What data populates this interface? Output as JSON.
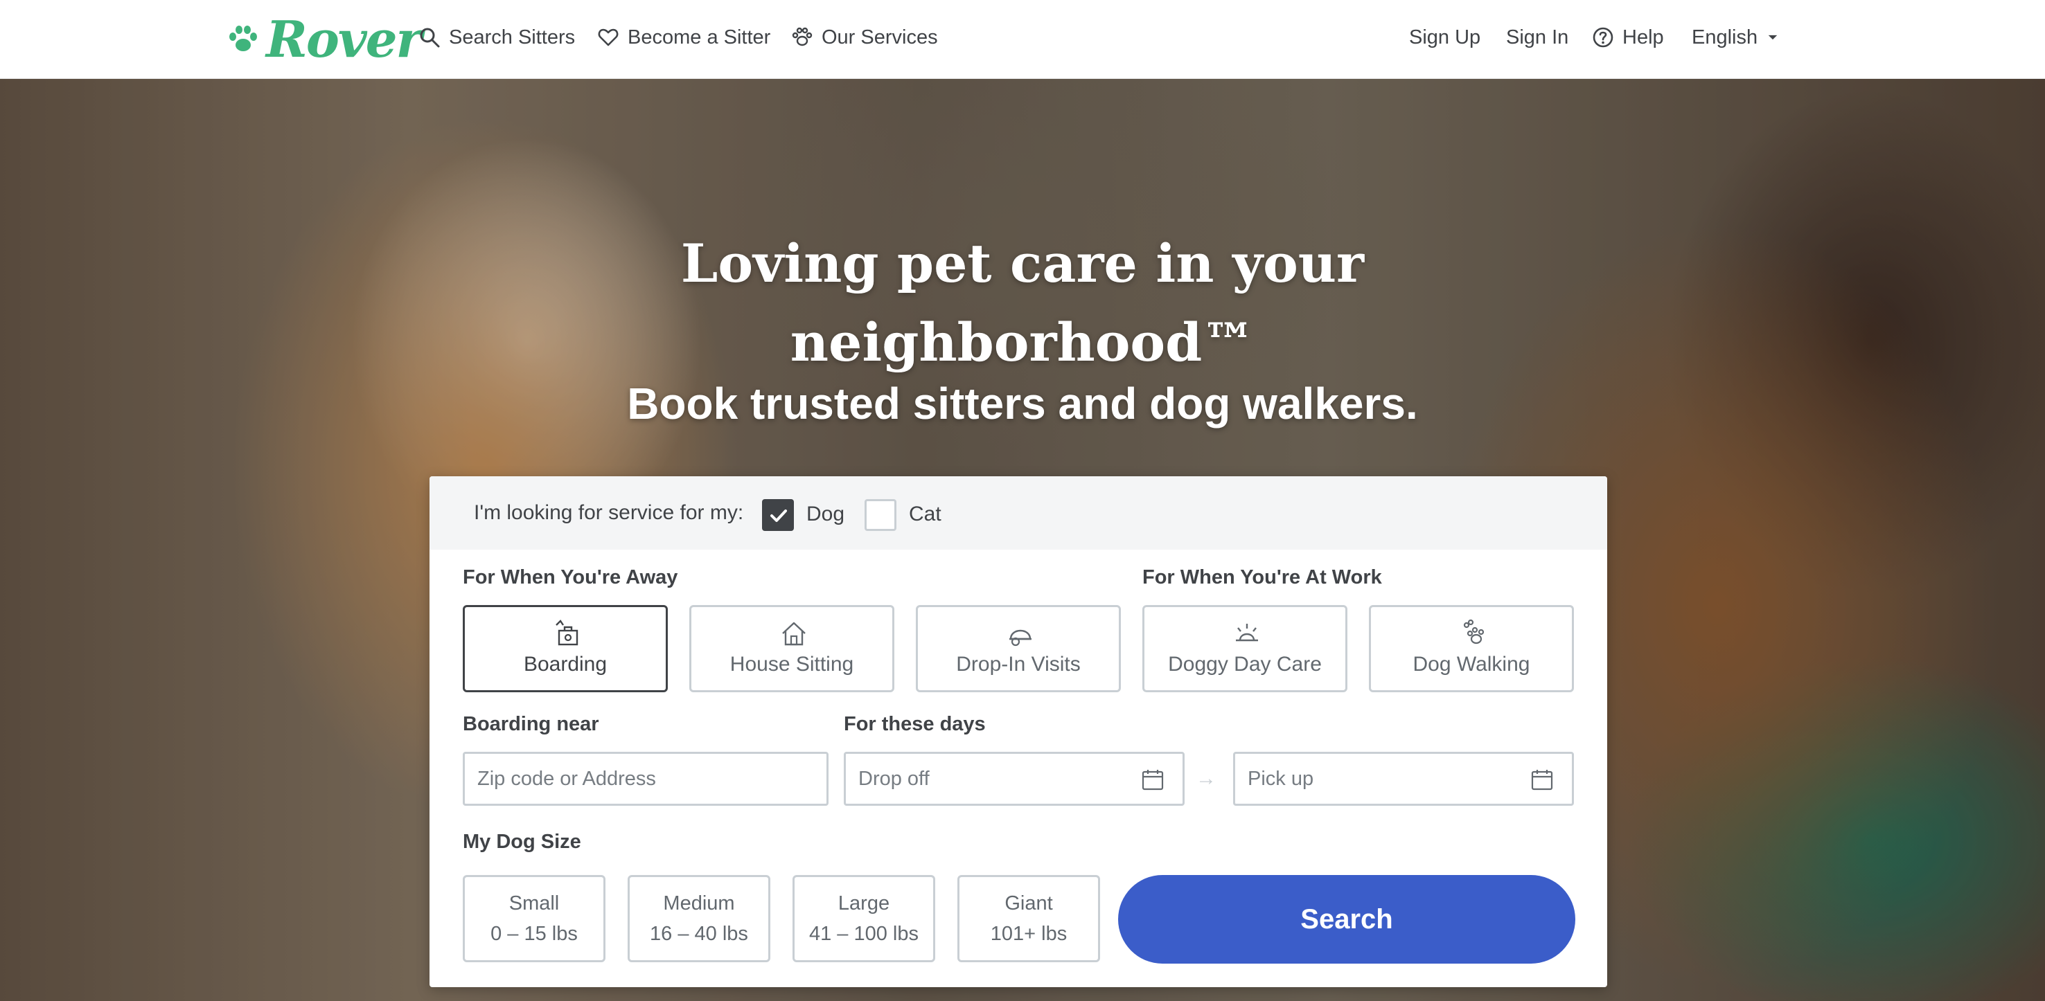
{
  "brand": {
    "name": "Rover",
    "color": "#3fb47c"
  },
  "nav": {
    "search_sitters": "Search Sitters",
    "become_sitter": "Become a Sitter",
    "our_services": "Our Services",
    "sign_up": "Sign Up",
    "sign_in": "Sign In",
    "help": "Help",
    "language": "English"
  },
  "hero": {
    "title_line1": "Loving pet care in your",
    "title_line2": "neighborhood™",
    "subtitle": "Book trusted sitters and dog walkers."
  },
  "search": {
    "pet_prompt": "I'm looking for service for my:",
    "pets": [
      {
        "label": "Dog",
        "checked": true
      },
      {
        "label": "Cat",
        "checked": false
      }
    ],
    "away_label": "For When You're Away",
    "work_label": "For When You're At Work",
    "services": [
      {
        "label": "Boarding",
        "icon": "boarding-icon",
        "selected": true
      },
      {
        "label": "House Sitting",
        "icon": "house-icon",
        "selected": false
      },
      {
        "label": "Drop-In Visits",
        "icon": "drop-in-icon",
        "selected": false
      },
      {
        "label": "Doggy Day Care",
        "icon": "sun-icon",
        "selected": false
      },
      {
        "label": "Dog Walking",
        "icon": "paw-walking-icon",
        "selected": false
      }
    ],
    "location_label": "Boarding near",
    "location_placeholder": "Zip code or Address",
    "dates_label": "For these days",
    "dropoff_placeholder": "Drop off",
    "pickup_placeholder": "Pick up",
    "arrow": "→",
    "size_label": "My Dog Size",
    "sizes": [
      {
        "name": "Small",
        "range": "0 – 15 lbs"
      },
      {
        "name": "Medium",
        "range": "16 – 40 lbs"
      },
      {
        "name": "Large",
        "range": "41 – 100 lbs"
      },
      {
        "name": "Giant",
        "range": "101+ lbs"
      }
    ],
    "button": "Search",
    "button_color": "#3b5dc9"
  }
}
